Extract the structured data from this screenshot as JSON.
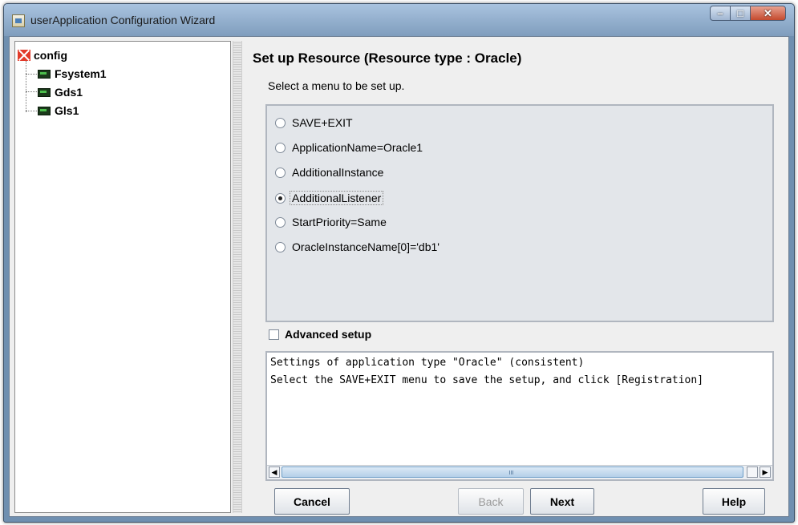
{
  "window": {
    "title": "userApplication Configuration Wizard"
  },
  "tree": {
    "root": "config",
    "children": [
      "Fsystem1",
      "Gds1",
      "Gls1"
    ]
  },
  "main": {
    "heading": "Set up Resource (Resource type : Oracle)",
    "subheading": "Select a menu to be set up.",
    "menu_options": [
      {
        "label": "SAVE+EXIT",
        "selected": false
      },
      {
        "label": "ApplicationName=Oracle1",
        "selected": false
      },
      {
        "label": "AdditionalInstance",
        "selected": false
      },
      {
        "label": "AdditionalListener",
        "selected": true
      },
      {
        "label": "StartPriority=Same",
        "selected": false
      },
      {
        "label": "OracleInstanceName[0]='db1'",
        "selected": false
      }
    ],
    "advanced_setup": {
      "label": "Advanced setup",
      "checked": false
    },
    "log_lines": [
      "Settings of application type \"Oracle\" (consistent)",
      "Select the SAVE+EXIT menu to save the setup, and click [Registration]"
    ]
  },
  "buttons": {
    "cancel": "Cancel",
    "back": "Back",
    "next": "Next",
    "help": "Help"
  },
  "colors": {
    "window_frame": "#6f8fb0",
    "close_button": "#c44a2e",
    "panel_bg": "#efefef"
  }
}
